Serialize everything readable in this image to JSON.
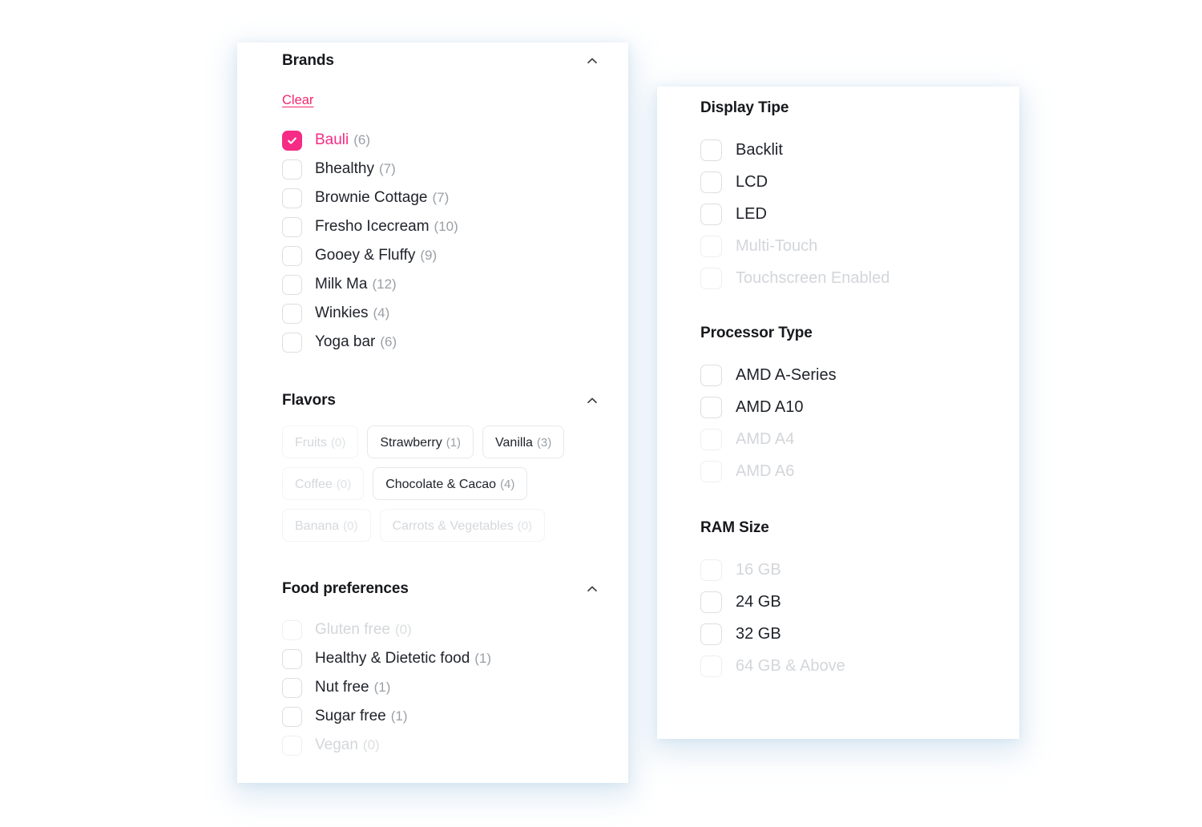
{
  "theme": {
    "accent": "#f62b85",
    "link": "#f2276f",
    "text": "#20232a",
    "muted": "#9aa0a6",
    "disabled": "#d3d6da",
    "panel_bg": "#ffffff",
    "page_bg": "#ffffff",
    "shadow": "#b0cde4"
  },
  "left_panel": {
    "brands": {
      "title": "Brands",
      "collapse_icon": "chevron-up-icon",
      "clear_label": "Clear",
      "items": [
        {
          "label": "Bauli",
          "count": "(6)",
          "checked": true,
          "disabled": false
        },
        {
          "label": "Bhealthy",
          "count": "(7)",
          "checked": false,
          "disabled": false
        },
        {
          "label": "Brownie Cottage",
          "count": "(7)",
          "checked": false,
          "disabled": false
        },
        {
          "label": "Fresho Icecream",
          "count": "(10)",
          "checked": false,
          "disabled": false
        },
        {
          "label": "Gooey & Fluffy",
          "count": "(9)",
          "checked": false,
          "disabled": false
        },
        {
          "label": "Milk Ma",
          "count": "(12)",
          "checked": false,
          "disabled": false
        },
        {
          "label": "Winkies",
          "count": "(4)",
          "checked": false,
          "disabled": false
        },
        {
          "label": "Yoga bar",
          "count": "(6)",
          "checked": false,
          "disabled": false
        }
      ]
    },
    "flavors": {
      "title": "Flavors",
      "collapse_icon": "chevron-up-icon",
      "chips": [
        {
          "label": "Fruits",
          "count": "(0)",
          "disabled": true
        },
        {
          "label": "Strawberry",
          "count": "(1)",
          "disabled": false
        },
        {
          "label": "Vanilla",
          "count": "(3)",
          "disabled": false
        },
        {
          "label": "Coffee",
          "count": "(0)",
          "disabled": true
        },
        {
          "label": "Chocolate & Cacao",
          "count": "(4)",
          "disabled": false
        },
        {
          "label": "Banana",
          "count": "(0)",
          "disabled": true
        },
        {
          "label": "Carrots & Vegetables",
          "count": "(0)",
          "disabled": true
        }
      ]
    },
    "food_preferences": {
      "title": "Food preferences",
      "collapse_icon": "chevron-up-icon",
      "items": [
        {
          "label": "Gluten free",
          "count": "(0)",
          "checked": false,
          "disabled": true
        },
        {
          "label": "Healthy & Dietetic food",
          "count": "(1)",
          "checked": false,
          "disabled": false
        },
        {
          "label": "Nut free",
          "count": "(1)",
          "checked": false,
          "disabled": false
        },
        {
          "label": "Sugar free",
          "count": "(1)",
          "checked": false,
          "disabled": false
        },
        {
          "label": "Vegan",
          "count": "(0)",
          "checked": false,
          "disabled": true
        }
      ]
    }
  },
  "right_panel": {
    "display_type": {
      "title": "Display Tipe",
      "items": [
        {
          "label": "Backlit",
          "checked": false,
          "disabled": false
        },
        {
          "label": "LCD",
          "checked": false,
          "disabled": false
        },
        {
          "label": "LED",
          "checked": false,
          "disabled": false
        },
        {
          "label": "Multi-Touch",
          "checked": false,
          "disabled": true
        },
        {
          "label": "Touchscreen Enabled",
          "checked": false,
          "disabled": true
        }
      ]
    },
    "processor_type": {
      "title": "Processor Type",
      "items": [
        {
          "label": "AMD A-Series",
          "checked": false,
          "disabled": false
        },
        {
          "label": "AMD A10",
          "checked": false,
          "disabled": false
        },
        {
          "label": "AMD A4",
          "checked": false,
          "disabled": true
        },
        {
          "label": "AMD A6",
          "checked": false,
          "disabled": true
        }
      ]
    },
    "ram_size": {
      "title": "RAM Size",
      "items": [
        {
          "label": "16 GB",
          "checked": false,
          "disabled": true
        },
        {
          "label": "24 GB",
          "checked": false,
          "disabled": false
        },
        {
          "label": "32 GB",
          "checked": false,
          "disabled": false
        },
        {
          "label": "64 GB & Above",
          "checked": false,
          "disabled": true
        }
      ]
    }
  }
}
